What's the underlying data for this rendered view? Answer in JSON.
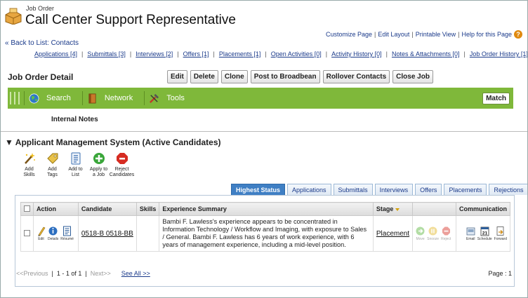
{
  "header": {
    "object_type": "Job Order",
    "title": "Call Center Support Representative",
    "back_link": "« Back to List: Contacts",
    "top_links": [
      "Customize Page",
      "Edit Layout",
      "Printable View",
      "Help for this Page"
    ],
    "help_icon": "?"
  },
  "related_links": [
    "Applications [4]",
    "Submittals [3]",
    "Interviews [2]",
    "Offers [1]",
    "Placements [1]",
    "Open Activities [0]",
    "Activity History [0]",
    "Notes & Attachments [0]",
    "Job Order History [1]"
  ],
  "detail": {
    "title": "Job Order Detail",
    "buttons": [
      "Edit",
      "Delete",
      "Clone",
      "Post to Broadbean",
      "Rollover Contacts",
      "Close Job"
    ]
  },
  "toolbar": {
    "search": "Search",
    "network": "Network",
    "tools": "Tools",
    "match": "Match"
  },
  "internal_notes": "Internal Notes",
  "ams": {
    "title": "Applicant Management System (Active Candidates)",
    "tools": [
      {
        "l1": "Add",
        "l2": "Skills",
        "icon": "wand-icon"
      },
      {
        "l1": "Add",
        "l2": "Tags",
        "icon": "tag-icon"
      },
      {
        "l1": "Add to",
        "l2": "List",
        "icon": "list-icon"
      },
      {
        "l1": "Apply to",
        "l2": "a Job",
        "icon": "plus-circle-icon"
      },
      {
        "l1": "Reject",
        "l2": "Candidates",
        "icon": "stop-icon"
      }
    ],
    "tabs": [
      "Highest Status",
      "Applications",
      "Submittals",
      "Interviews",
      "Offers",
      "Placements",
      "Rejections"
    ],
    "columns": [
      "Action",
      "Candidate",
      "Skills",
      "Experience Summary",
      "Stage",
      "",
      "Communication"
    ],
    "row": {
      "actions": [
        "Edit",
        "Details",
        "Résumé"
      ],
      "candidate": "0518-B 0518-BB",
      "skills": "",
      "summary": "Bambi F. Lawless's experience appears to be concentrated in Information Technology / Workflow and Imaging, with exposure to Sales / General. Bambi F. Lawless has 6 years of work experience, with 6 years of management experience, including a mid-level position.",
      "stage": "Placement",
      "stage_actions": [
        "Move",
        "Snooze",
        "Reject"
      ],
      "communication": [
        "Email",
        "Schedule",
        "Forward"
      ],
      "calendar_day": "21"
    },
    "pager": {
      "previous": "<<Previous",
      "range": "1 - 1 of 1",
      "next": "Next>>",
      "see_all": "See All >>",
      "page": "Page : 1"
    }
  },
  "colors": {
    "toolbar_green": "#7fb83a",
    "active_tab": "#3f7fc4",
    "link": "#1a3a8a"
  }
}
